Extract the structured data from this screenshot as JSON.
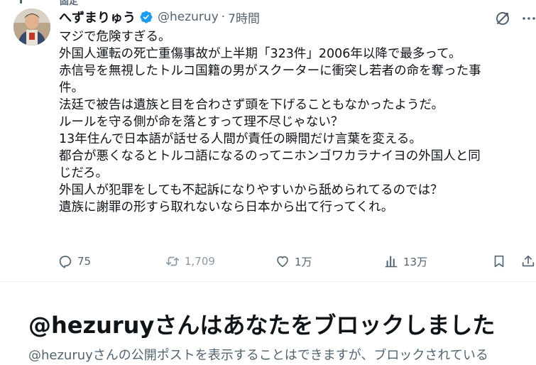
{
  "pinned_label": "固定",
  "tweet": {
    "display_name": "へずまりゅう",
    "handle": "@hezuruy",
    "separator": "·",
    "time": "7時間",
    "verified": true,
    "lines": [
      "マジで危険すぎる。",
      "外国人運転の死亡重傷事故が上半期「323件」2006年以降で最多って。",
      "赤信号を無視したトルコ国籍の男がスクーターに衝突し若者の命を奪った事",
      "件。",
      "法廷で被告は遺族と目を合わさず頭を下げることもなかったようだ。",
      "ルールを守る側が命を落とすって理不尽じゃない？",
      "13年住んで日本語が話せる人間が責任の瞬間だけ言葉を変える。",
      "都合が悪くなるとトルコ語になるのってニホンゴワカラナイヨの外国人と同",
      "じだろ。",
      "外国人が犯罪をしても不起訴になりやすいから舐められてるのでは？",
      "遺族に謝罪の形すら取れないなら日本から出て行ってくれ。"
    ],
    "actions": {
      "replies": "75",
      "reposts": "1,709",
      "likes": "1万",
      "views": "13万"
    }
  },
  "block_notice": {
    "title": "@hezuruyさんはあなたをブロックしました",
    "description": "@hezuruyさんの公開ポストを表示することはできますが、ブロックされている"
  },
  "colors": {
    "text": "#0f1419",
    "secondary": "#536471",
    "verified_blue": "#1d9bf0",
    "divider": "#eff3f4"
  },
  "icons": {
    "reply": "reply-icon",
    "repost": "repost-icon",
    "like": "heart-icon",
    "views": "views-chart-icon",
    "bookmark": "bookmark-icon",
    "share": "share-icon",
    "grok": "grok-icon",
    "verified": "verified-badge-icon"
  }
}
